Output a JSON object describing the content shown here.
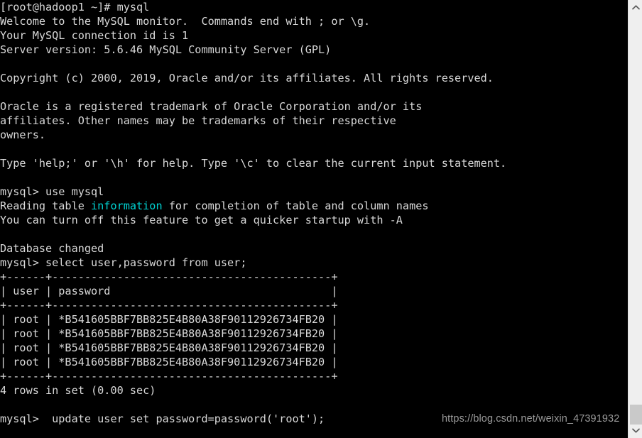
{
  "terminal": {
    "lines": [
      {
        "text": "[root@hadoop1 ~]# mysql"
      },
      {
        "text": "Welcome to the MySQL monitor.  Commands end with ; or \\g."
      },
      {
        "text": "Your MySQL connection id is 1"
      },
      {
        "text": "Server version: 5.6.46 MySQL Community Server (GPL)"
      },
      {
        "text": ""
      },
      {
        "text": "Copyright (c) 2000, 2019, Oracle and/or its affiliates. All rights reserved."
      },
      {
        "text": ""
      },
      {
        "text": "Oracle is a registered trademark of Oracle Corporation and/or its"
      },
      {
        "text": "affiliates. Other names may be trademarks of their respective"
      },
      {
        "text": "owners."
      },
      {
        "text": ""
      },
      {
        "text": "Type 'help;' or '\\h' for help. Type '\\c' to clear the current input statement."
      },
      {
        "text": ""
      },
      {
        "text": "mysql> use mysql"
      },
      {
        "pre": "Reading table ",
        "highlight": "information",
        "post": " for completion of table and column names"
      },
      {
        "text": "You can turn off this feature to get a quicker startup with -A"
      },
      {
        "text": ""
      },
      {
        "text": "Database changed"
      },
      {
        "text": "mysql> select user,password from user;"
      },
      {
        "text": "+------+-------------------------------------------+"
      },
      {
        "text": "| user | password                                  |"
      },
      {
        "text": "+------+-------------------------------------------+"
      },
      {
        "text": "| root | *B541605BBF7BB825E4B80A38F90112926734FB20 |"
      },
      {
        "text": "| root | *B541605BBF7BB825E4B80A38F90112926734FB20 |"
      },
      {
        "text": "| root | *B541605BBF7BB825E4B80A38F90112926734FB20 |"
      },
      {
        "text": "| root | *B541605BBF7BB825E4B80A38F90112926734FB20 |"
      },
      {
        "text": "+------+-------------------------------------------+"
      },
      {
        "text": "4 rows in set (0.00 sec)"
      },
      {
        "text": ""
      },
      {
        "text": "mysql>  update user set password=password('root');"
      }
    ],
    "colors": {
      "background": "#000000",
      "foreground": "#d8d8d8",
      "highlight": "#00d3d3"
    }
  },
  "scrollbar": {
    "up_arrow": "chevron-up-icon",
    "down_arrow": "chevron-down-icon",
    "track_color": "#efefef",
    "thumb_color": "#c9c9c9"
  },
  "watermark": {
    "text": "https://blog.csdn.net/weixin_47391932",
    "color": "#9a9a9a"
  }
}
